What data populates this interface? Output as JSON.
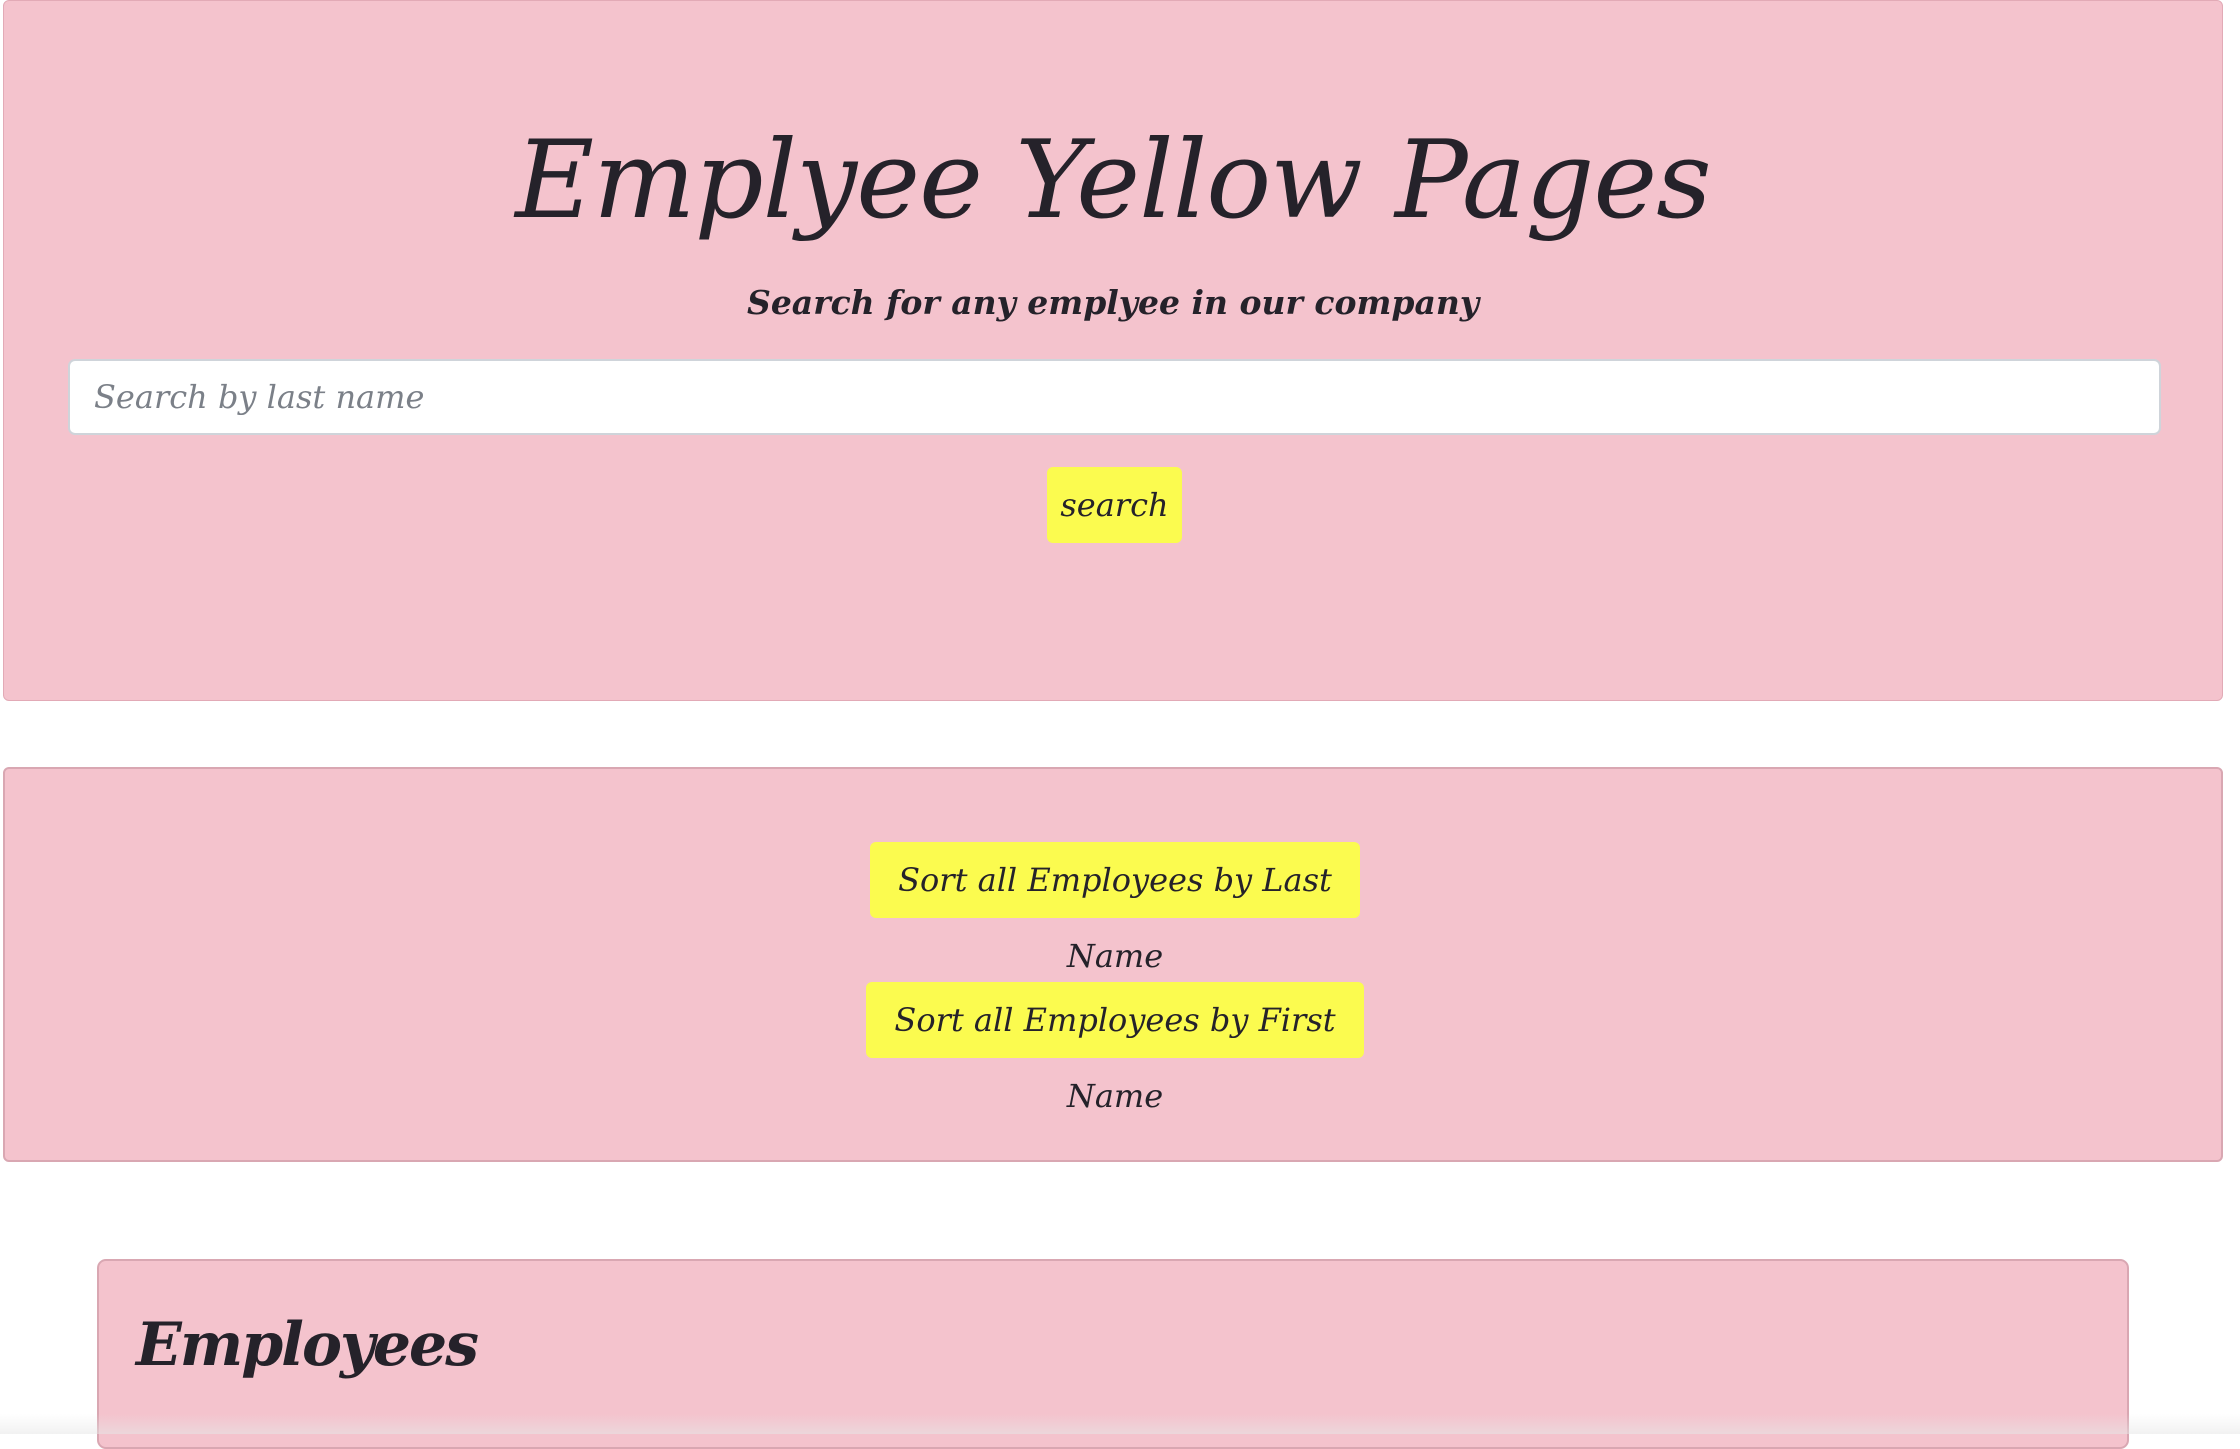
{
  "hero": {
    "title": "Emplyee Yellow Pages",
    "subtitle": "Search for any emplyee in our company",
    "search_placeholder": "Search by last name",
    "search_value": "",
    "search_button_label": "search"
  },
  "sort_panel": {
    "sort_last_label": "Sort all Employees by Last Name",
    "sort_first_label": "Sort all Employees by First Name"
  },
  "employees": {
    "heading": "Employees"
  },
  "colors": {
    "panel_background": "#f4c3cd",
    "button_background": "#fbfb4f",
    "text": "#25222a"
  }
}
